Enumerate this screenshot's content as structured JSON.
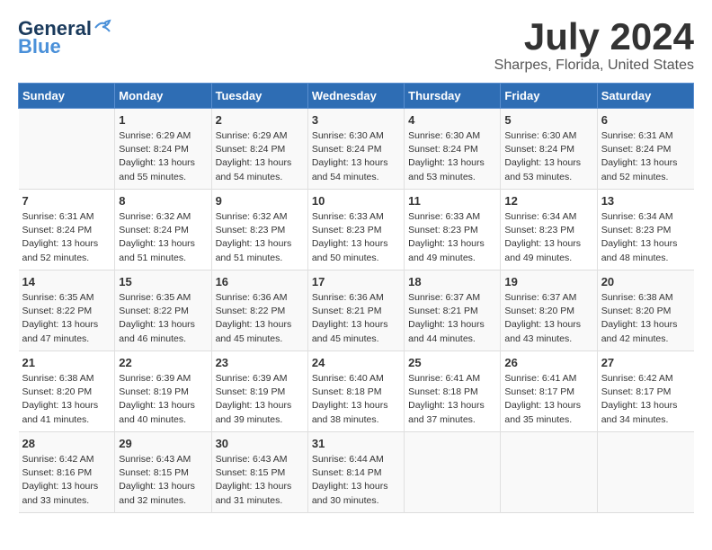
{
  "logo": {
    "line1": "General",
    "line2": "Blue"
  },
  "title": "July 2024",
  "location": "Sharpes, Florida, United States",
  "days_of_week": [
    "Sunday",
    "Monday",
    "Tuesday",
    "Wednesday",
    "Thursday",
    "Friday",
    "Saturday"
  ],
  "weeks": [
    [
      {
        "day": "",
        "info": ""
      },
      {
        "day": "1",
        "info": "Sunrise: 6:29 AM\nSunset: 8:24 PM\nDaylight: 13 hours\nand 55 minutes."
      },
      {
        "day": "2",
        "info": "Sunrise: 6:29 AM\nSunset: 8:24 PM\nDaylight: 13 hours\nand 54 minutes."
      },
      {
        "day": "3",
        "info": "Sunrise: 6:30 AM\nSunset: 8:24 PM\nDaylight: 13 hours\nand 54 minutes."
      },
      {
        "day": "4",
        "info": "Sunrise: 6:30 AM\nSunset: 8:24 PM\nDaylight: 13 hours\nand 53 minutes."
      },
      {
        "day": "5",
        "info": "Sunrise: 6:30 AM\nSunset: 8:24 PM\nDaylight: 13 hours\nand 53 minutes."
      },
      {
        "day": "6",
        "info": "Sunrise: 6:31 AM\nSunset: 8:24 PM\nDaylight: 13 hours\nand 52 minutes."
      }
    ],
    [
      {
        "day": "7",
        "info": "Sunrise: 6:31 AM\nSunset: 8:24 PM\nDaylight: 13 hours\nand 52 minutes."
      },
      {
        "day": "8",
        "info": "Sunrise: 6:32 AM\nSunset: 8:24 PM\nDaylight: 13 hours\nand 51 minutes."
      },
      {
        "day": "9",
        "info": "Sunrise: 6:32 AM\nSunset: 8:23 PM\nDaylight: 13 hours\nand 51 minutes."
      },
      {
        "day": "10",
        "info": "Sunrise: 6:33 AM\nSunset: 8:23 PM\nDaylight: 13 hours\nand 50 minutes."
      },
      {
        "day": "11",
        "info": "Sunrise: 6:33 AM\nSunset: 8:23 PM\nDaylight: 13 hours\nand 49 minutes."
      },
      {
        "day": "12",
        "info": "Sunrise: 6:34 AM\nSunset: 8:23 PM\nDaylight: 13 hours\nand 49 minutes."
      },
      {
        "day": "13",
        "info": "Sunrise: 6:34 AM\nSunset: 8:23 PM\nDaylight: 13 hours\nand 48 minutes."
      }
    ],
    [
      {
        "day": "14",
        "info": "Sunrise: 6:35 AM\nSunset: 8:22 PM\nDaylight: 13 hours\nand 47 minutes."
      },
      {
        "day": "15",
        "info": "Sunrise: 6:35 AM\nSunset: 8:22 PM\nDaylight: 13 hours\nand 46 minutes."
      },
      {
        "day": "16",
        "info": "Sunrise: 6:36 AM\nSunset: 8:22 PM\nDaylight: 13 hours\nand 45 minutes."
      },
      {
        "day": "17",
        "info": "Sunrise: 6:36 AM\nSunset: 8:21 PM\nDaylight: 13 hours\nand 45 minutes."
      },
      {
        "day": "18",
        "info": "Sunrise: 6:37 AM\nSunset: 8:21 PM\nDaylight: 13 hours\nand 44 minutes."
      },
      {
        "day": "19",
        "info": "Sunrise: 6:37 AM\nSunset: 8:20 PM\nDaylight: 13 hours\nand 43 minutes."
      },
      {
        "day": "20",
        "info": "Sunrise: 6:38 AM\nSunset: 8:20 PM\nDaylight: 13 hours\nand 42 minutes."
      }
    ],
    [
      {
        "day": "21",
        "info": "Sunrise: 6:38 AM\nSunset: 8:20 PM\nDaylight: 13 hours\nand 41 minutes."
      },
      {
        "day": "22",
        "info": "Sunrise: 6:39 AM\nSunset: 8:19 PM\nDaylight: 13 hours\nand 40 minutes."
      },
      {
        "day": "23",
        "info": "Sunrise: 6:39 AM\nSunset: 8:19 PM\nDaylight: 13 hours\nand 39 minutes."
      },
      {
        "day": "24",
        "info": "Sunrise: 6:40 AM\nSunset: 8:18 PM\nDaylight: 13 hours\nand 38 minutes."
      },
      {
        "day": "25",
        "info": "Sunrise: 6:41 AM\nSunset: 8:18 PM\nDaylight: 13 hours\nand 37 minutes."
      },
      {
        "day": "26",
        "info": "Sunrise: 6:41 AM\nSunset: 8:17 PM\nDaylight: 13 hours\nand 35 minutes."
      },
      {
        "day": "27",
        "info": "Sunrise: 6:42 AM\nSunset: 8:17 PM\nDaylight: 13 hours\nand 34 minutes."
      }
    ],
    [
      {
        "day": "28",
        "info": "Sunrise: 6:42 AM\nSunset: 8:16 PM\nDaylight: 13 hours\nand 33 minutes."
      },
      {
        "day": "29",
        "info": "Sunrise: 6:43 AM\nSunset: 8:15 PM\nDaylight: 13 hours\nand 32 minutes."
      },
      {
        "day": "30",
        "info": "Sunrise: 6:43 AM\nSunset: 8:15 PM\nDaylight: 13 hours\nand 31 minutes."
      },
      {
        "day": "31",
        "info": "Sunrise: 6:44 AM\nSunset: 8:14 PM\nDaylight: 13 hours\nand 30 minutes."
      },
      {
        "day": "",
        "info": ""
      },
      {
        "day": "",
        "info": ""
      },
      {
        "day": "",
        "info": ""
      }
    ]
  ]
}
